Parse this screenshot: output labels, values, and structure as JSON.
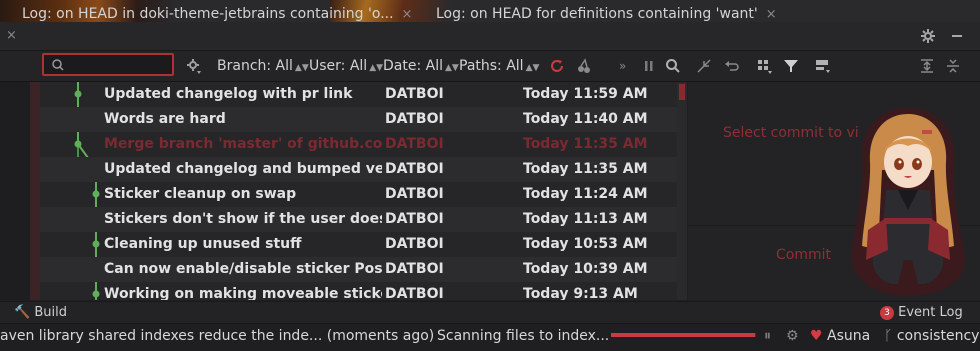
{
  "tabs": [
    {
      "label": "Log: on HEAD in doki-theme-jetbrains containing 'o...",
      "close": "×"
    },
    {
      "label": "Log: on HEAD for definitions containing 'want'",
      "close": "×"
    }
  ],
  "tab_left_close": "×",
  "search": {
    "value": "",
    "placeholder": ""
  },
  "filters": {
    "branch": "Branch: All",
    "user": "User: All",
    "date": "Date: All",
    "paths": "Paths: All"
  },
  "commits": [
    {
      "message": "Updated changelog with pr link",
      "author": "DATBOI",
      "date": "Today 11:59 AM",
      "merge": false
    },
    {
      "message": "Words are hard",
      "author": "DATBOI",
      "date": "Today 11:40 AM",
      "merge": false
    },
    {
      "message": "Merge branch 'master' of github.com:d",
      "author": "DATBOI",
      "date": "Today 11:35 AM",
      "merge": true
    },
    {
      "message": "Updated changelog and bumped versio",
      "author": "DATBOI",
      "date": "Today 11:35 AM",
      "merge": false
    },
    {
      "message": "Sticker cleanup on swap",
      "author": "DATBOI",
      "date": "Today 11:24 AM",
      "merge": false
    },
    {
      "message": "Stickers don't show if the user doesn't",
      "author": "DATBOI",
      "date": "Today 11:13 AM",
      "merge": false
    },
    {
      "message": "Cleaning up unused stuff",
      "author": "DATBOI",
      "date": "Today 10:53 AM",
      "merge": false
    },
    {
      "message": "Can now enable/disable sticker Positio",
      "author": "DATBOI",
      "date": "Today 10:39 AM",
      "merge": false
    },
    {
      "message": "Working on making moveable stickers",
      "author": "DATBOI",
      "date": "Today 9:13 AM",
      "merge": false
    }
  ],
  "details": {
    "select_hint": "Select commit to vi",
    "commit_hint": "Commit"
  },
  "toolstrip": {
    "build": "Build",
    "event_log": "Event Log",
    "event_count": "3"
  },
  "status": {
    "left_message": "aven library shared indexes reduce the inde... (moments ago)",
    "scanning": "Scanning files to index...",
    "progress": 0.99,
    "theme": "Asuna",
    "branch": "consistency"
  },
  "colors": {
    "accent": "#c93a43",
    "graph_green": "#5fae5a"
  }
}
